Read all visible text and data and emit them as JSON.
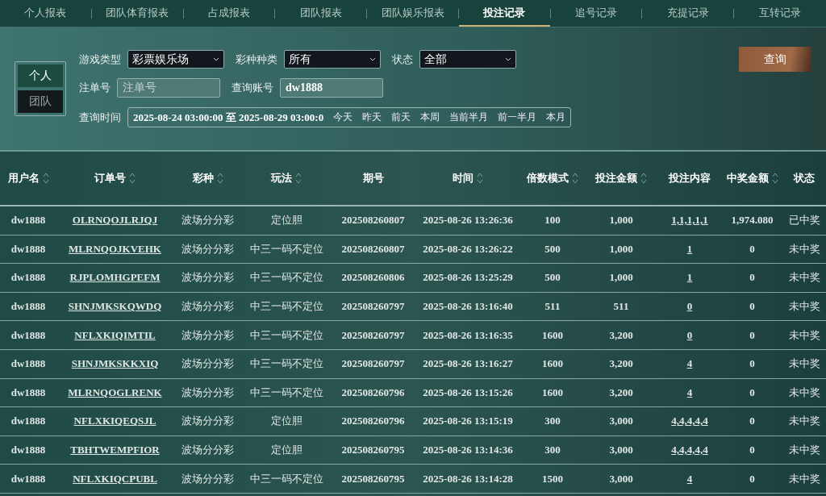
{
  "tabs": [
    {
      "label": "个人报表",
      "selected": false
    },
    {
      "label": "团队体育报表",
      "selected": false
    },
    {
      "label": "占成报表",
      "selected": false
    },
    {
      "label": "团队报表",
      "selected": false
    },
    {
      "label": "团队娱乐报表",
      "selected": false
    },
    {
      "label": "投注记录",
      "selected": true
    },
    {
      "label": "追号记录",
      "selected": false
    },
    {
      "label": "充提记录",
      "selected": false
    },
    {
      "label": "互转记录",
      "selected": false
    }
  ],
  "scope": [
    {
      "label": "个人",
      "selected": true
    },
    {
      "label": "团队",
      "selected": false
    }
  ],
  "filters": {
    "game_type": {
      "label": "游戏类型",
      "value": "彩票娱乐场"
    },
    "lottery_type": {
      "label": "彩种种类",
      "value": "所有"
    },
    "status": {
      "label": "状态",
      "value": "全部"
    },
    "order_no": {
      "label": "注单号",
      "placeholder": "注单号"
    },
    "account": {
      "label": "查询账号",
      "value": "dw1888"
    },
    "time": {
      "label": "查询时间",
      "value": "2025-08-24 03:00:00 至 2025-08-29 03:00:0",
      "shortcuts": [
        "今天",
        "昨天",
        "前天",
        "本周",
        "当前半月",
        "前一半月",
        "本月"
      ]
    }
  },
  "query_button": "查询",
  "table": {
    "columns": [
      {
        "label": "用户名",
        "sortable": true
      },
      {
        "label": "订单号",
        "sortable": true
      },
      {
        "label": "彩种",
        "sortable": true
      },
      {
        "label": "玩法",
        "sortable": true
      },
      {
        "label": "期号",
        "sortable": false
      },
      {
        "label": "时间",
        "sortable": true
      },
      {
        "label": "倍数模式",
        "sortable": true
      },
      {
        "label": "投注金额",
        "sortable": true
      },
      {
        "label": "投注内容",
        "sortable": false
      },
      {
        "label": "中奖金额",
        "sortable": true
      },
      {
        "label": "状态",
        "sortable": false
      }
    ],
    "rows": [
      [
        "dw1888",
        "OLRNQOJLRJQJ",
        "波场分分彩",
        "定位胆",
        "202508260807",
        "2025-08-26 13:26:36",
        "100",
        "1,000",
        "1,1,1,1,1",
        "1,974.080",
        "已中奖"
      ],
      [
        "dw1888",
        "MLRNQOJKVEHK",
        "波场分分彩",
        "中三一码不定位",
        "202508260807",
        "2025-08-26 13:26:22",
        "500",
        "1,000",
        "1",
        "0",
        "未中奖"
      ],
      [
        "dw1888",
        "RJPLOMHGPEFM",
        "波场分分彩",
        "中三一码不定位",
        "202508260806",
        "2025-08-26 13:25:29",
        "500",
        "1,000",
        "1",
        "0",
        "未中奖"
      ],
      [
        "dw1888",
        "SHNJMKSKQWDQ",
        "波场分分彩",
        "中三一码不定位",
        "202508260797",
        "2025-08-26 13:16:40",
        "511",
        "511",
        "0",
        "0",
        "未中奖"
      ],
      [
        "dw1888",
        "NFLXKIQIMTIL",
        "波场分分彩",
        "中三一码不定位",
        "202508260797",
        "2025-08-26 13:16:35",
        "1600",
        "3,200",
        "0",
        "0",
        "未中奖"
      ],
      [
        "dw1888",
        "SHNJMKSKKXIQ",
        "波场分分彩",
        "中三一码不定位",
        "202508260797",
        "2025-08-26 13:16:27",
        "1600",
        "3,200",
        "4",
        "0",
        "未中奖"
      ],
      [
        "dw1888",
        "MLRNQOGLRENK",
        "波场分分彩",
        "中三一码不定位",
        "202508260796",
        "2025-08-26 13:15:26",
        "1600",
        "3,200",
        "4",
        "0",
        "未中奖"
      ],
      [
        "dw1888",
        "NFLXKIQEQSJL",
        "波场分分彩",
        "定位胆",
        "202508260796",
        "2025-08-26 13:15:19",
        "300",
        "3,000",
        "4,4,4,4,4",
        "0",
        "未中奖"
      ],
      [
        "dw1888",
        "TBHTWEMPFIOR",
        "波场分分彩",
        "定位胆",
        "202508260795",
        "2025-08-26 13:14:36",
        "300",
        "3,000",
        "4,4,4,4,4",
        "0",
        "未中奖"
      ],
      [
        "dw1888",
        "NFLXKIQCPUBL",
        "波场分分彩",
        "中三一码不定位",
        "202508260795",
        "2025-08-26 13:14:28",
        "1500",
        "3,000",
        "4",
        "0",
        "未中奖"
      ]
    ]
  }
}
